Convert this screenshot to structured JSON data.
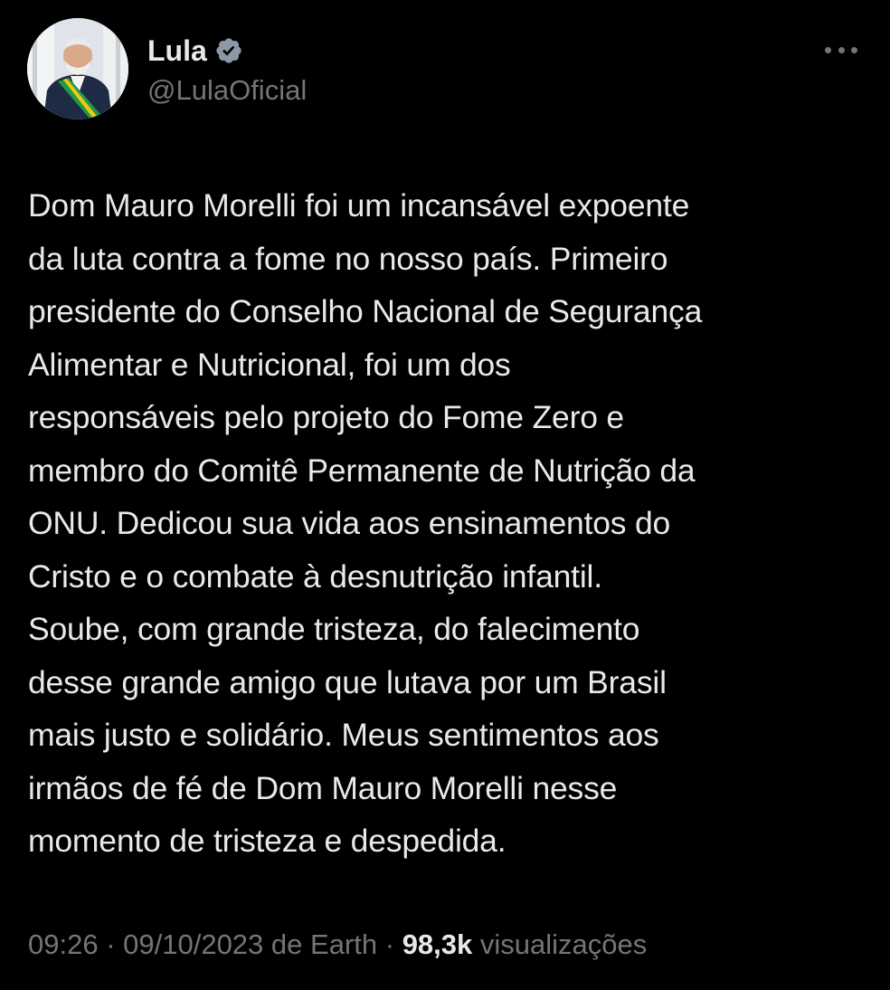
{
  "author": {
    "display_name": "Lula",
    "handle": "@LulaOficial",
    "verified": true,
    "verified_color": "#8b98a5"
  },
  "tweet": {
    "text": "Dom Mauro Morelli foi um incansável expoente\nda luta contra a fome no nosso país. Primeiro\npresidente do Conselho Nacional de Segurança\nAlimentar e Nutricional, foi um dos\nresponsáveis pelo projeto do Fome Zero e\nmembro do Comitê Permanente de Nutrição da\nONU. Dedicou sua vida aos ensinamentos do\nCristo e o combate à desnutrição infantil.\nSoube, com grande tristeza, do falecimento\ndesse grande amigo que lutava por um Brasil\nmais justo e solidário. Meus sentimentos aos\nirmãos de fé de Dom Mauro Morelli nesse\nmomento de tristeza e despedida."
  },
  "meta": {
    "time": "09:26",
    "date": "09/10/2023",
    "source": "de Earth",
    "separator": " · ",
    "views_count": "98,3k",
    "views_label": "visualizações"
  },
  "icons": {
    "avatar": "profile-photo",
    "verified": "verified-badge-icon",
    "more": "more-options-icon"
  },
  "colors": {
    "background": "#000000",
    "text_primary": "#e7e9ea",
    "text_secondary": "#71767b"
  }
}
